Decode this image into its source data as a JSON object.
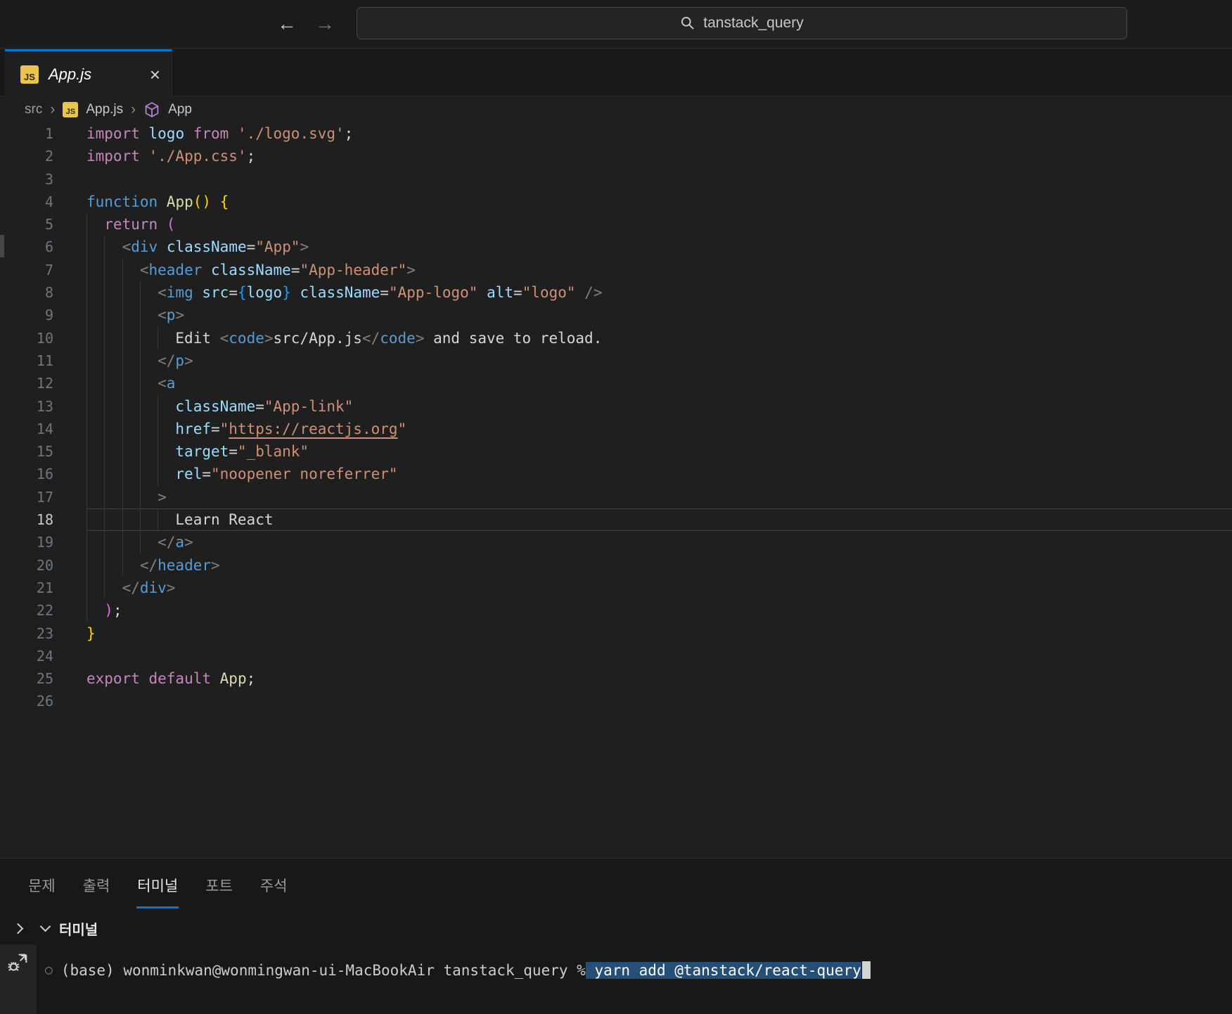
{
  "titlebar": {
    "search_value": "tanstack_query"
  },
  "icons": {
    "back": "←",
    "forward": "→",
    "close": "×",
    "breadcrumb_separator": "›",
    "terminal_command_circle": "○",
    "js_badge": "JS"
  },
  "colors": {
    "accent_blue": "#0078d4",
    "terminal_selection": "#264f78",
    "js_badge_yellow": "#e9c54b",
    "symbol_purple": "#b180d7"
  },
  "tab": {
    "label": "App.js"
  },
  "breadcrumb": {
    "items": [
      "src",
      "App.js",
      "App"
    ]
  },
  "editor": {
    "lines": [
      {
        "n": 1,
        "indent": 0,
        "tokens": [
          [
            "kw",
            "import "
          ],
          [
            "var",
            "logo "
          ],
          [
            "kw",
            "from "
          ],
          [
            "str",
            "'./logo.svg'"
          ],
          [
            "fg",
            ";"
          ]
        ]
      },
      {
        "n": 2,
        "indent": 0,
        "tokens": [
          [
            "kw",
            "import "
          ],
          [
            "str",
            "'./App.css'"
          ],
          [
            "fg",
            ";"
          ]
        ]
      },
      {
        "n": 3,
        "indent": 0,
        "tokens": []
      },
      {
        "n": 4,
        "indent": 0,
        "tokens": [
          [
            "kb",
            "function "
          ],
          [
            "fn",
            "App"
          ],
          [
            "b1",
            "()"
          ],
          [
            "fg",
            " "
          ],
          [
            "b1",
            "{"
          ]
        ]
      },
      {
        "n": 5,
        "indent": 2,
        "tokens": [
          [
            "kw",
            "return "
          ],
          [
            "b2",
            "("
          ]
        ]
      },
      {
        "n": 6,
        "indent": 4,
        "tokens": [
          [
            "pu",
            "<"
          ],
          [
            "tag",
            "div"
          ],
          [
            "fg",
            " "
          ],
          [
            "attr",
            "className"
          ],
          [
            "op",
            "="
          ],
          [
            "str",
            "\"App\""
          ],
          [
            "pu",
            ">"
          ]
        ]
      },
      {
        "n": 7,
        "indent": 6,
        "tokens": [
          [
            "pu",
            "<"
          ],
          [
            "tag",
            "header"
          ],
          [
            "fg",
            " "
          ],
          [
            "attr",
            "className"
          ],
          [
            "op",
            "="
          ],
          [
            "str",
            "\"App-header\""
          ],
          [
            "pu",
            ">"
          ]
        ]
      },
      {
        "n": 8,
        "indent": 8,
        "tokens": [
          [
            "pu",
            "<"
          ],
          [
            "tag",
            "img"
          ],
          [
            "fg",
            " "
          ],
          [
            "attr",
            "src"
          ],
          [
            "op",
            "="
          ],
          [
            "b3",
            "{"
          ],
          [
            "var",
            "logo"
          ],
          [
            "b3",
            "}"
          ],
          [
            "fg",
            " "
          ],
          [
            "attr",
            "className"
          ],
          [
            "op",
            "="
          ],
          [
            "str",
            "\"App-logo\""
          ],
          [
            "fg",
            " "
          ],
          [
            "attr",
            "alt"
          ],
          [
            "op",
            "="
          ],
          [
            "str",
            "\"logo\""
          ],
          [
            "fg",
            " "
          ],
          [
            "pu",
            "/>"
          ]
        ]
      },
      {
        "n": 9,
        "indent": 8,
        "tokens": [
          [
            "pu",
            "<"
          ],
          [
            "tag",
            "p"
          ],
          [
            "pu",
            ">"
          ]
        ]
      },
      {
        "n": 10,
        "indent": 10,
        "tokens": [
          [
            "fg",
            "Edit "
          ],
          [
            "pu",
            "<"
          ],
          [
            "tag",
            "code"
          ],
          [
            "pu",
            ">"
          ],
          [
            "fg",
            "src/App.js"
          ],
          [
            "pu",
            "</"
          ],
          [
            "tag",
            "code"
          ],
          [
            "pu",
            ">"
          ],
          [
            "fg",
            " and save to reload."
          ]
        ]
      },
      {
        "n": 11,
        "indent": 8,
        "tokens": [
          [
            "pu",
            "</"
          ],
          [
            "tag",
            "p"
          ],
          [
            "pu",
            ">"
          ]
        ]
      },
      {
        "n": 12,
        "indent": 8,
        "tokens": [
          [
            "pu",
            "<"
          ],
          [
            "tag",
            "a"
          ]
        ]
      },
      {
        "n": 13,
        "indent": 10,
        "tokens": [
          [
            "attr",
            "className"
          ],
          [
            "op",
            "="
          ],
          [
            "str",
            "\"App-link\""
          ]
        ]
      },
      {
        "n": 14,
        "indent": 10,
        "tokens": [
          [
            "attr",
            "href"
          ],
          [
            "op",
            "="
          ],
          [
            "str",
            "\""
          ],
          [
            "lnk",
            "https://reactjs.org"
          ],
          [
            "str",
            "\""
          ]
        ]
      },
      {
        "n": 15,
        "indent": 10,
        "tokens": [
          [
            "attr",
            "target"
          ],
          [
            "op",
            "="
          ],
          [
            "str",
            "\"_blank\""
          ]
        ]
      },
      {
        "n": 16,
        "indent": 10,
        "tokens": [
          [
            "attr",
            "rel"
          ],
          [
            "op",
            "="
          ],
          [
            "str",
            "\"noopener noreferrer\""
          ]
        ]
      },
      {
        "n": 17,
        "indent": 8,
        "tokens": [
          [
            "pu",
            ">"
          ]
        ]
      },
      {
        "n": 18,
        "indent": 10,
        "active": true,
        "tokens": [
          [
            "fg",
            "Learn React"
          ]
        ]
      },
      {
        "n": 19,
        "indent": 8,
        "tokens": [
          [
            "pu",
            "</"
          ],
          [
            "tag",
            "a"
          ],
          [
            "pu",
            ">"
          ]
        ]
      },
      {
        "n": 20,
        "indent": 6,
        "tokens": [
          [
            "pu",
            "</"
          ],
          [
            "tag",
            "header"
          ],
          [
            "pu",
            ">"
          ]
        ]
      },
      {
        "n": 21,
        "indent": 4,
        "tokens": [
          [
            "pu",
            "</"
          ],
          [
            "tag",
            "div"
          ],
          [
            "pu",
            ">"
          ]
        ]
      },
      {
        "n": 22,
        "indent": 2,
        "tokens": [
          [
            "b2",
            ")"
          ],
          [
            "fg",
            ";"
          ]
        ]
      },
      {
        "n": 23,
        "indent": 0,
        "tokens": [
          [
            "b1",
            "}"
          ]
        ]
      },
      {
        "n": 24,
        "indent": 0,
        "tokens": []
      },
      {
        "n": 25,
        "indent": 0,
        "tokens": [
          [
            "kw",
            "export default "
          ],
          [
            "fn",
            "App"
          ],
          [
            "fg",
            ";"
          ]
        ]
      },
      {
        "n": 26,
        "indent": 0,
        "tokens": []
      }
    ]
  },
  "panel": {
    "tabs": [
      {
        "label": "문제",
        "active": false
      },
      {
        "label": "출력",
        "active": false
      },
      {
        "label": "터미널",
        "active": true
      },
      {
        "label": "포트",
        "active": false
      },
      {
        "label": "주석",
        "active": false
      }
    ],
    "section_title": "터미널"
  },
  "terminal": {
    "prompt": "(base) wonminkwan@wonmingwan-ui-MacBookAir tanstack_query %",
    "selected_command": " yarn add @tanstack/react-query"
  }
}
